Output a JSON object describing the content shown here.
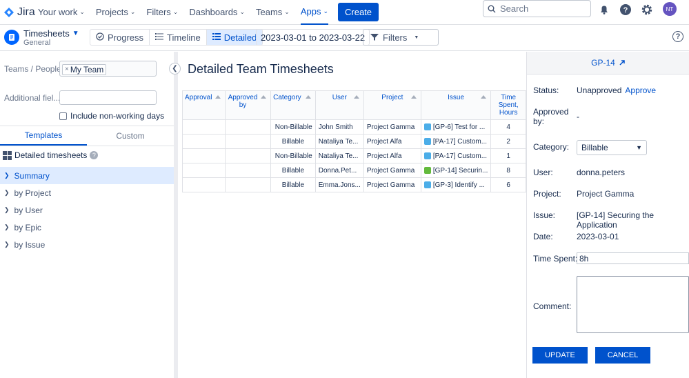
{
  "topnav": {
    "brand": "Jira",
    "items": [
      {
        "label": "Your work",
        "active": false
      },
      {
        "label": "Projects",
        "active": false
      },
      {
        "label": "Filters",
        "active": false
      },
      {
        "label": "Dashboards",
        "active": false
      },
      {
        "label": "Teams",
        "active": false
      },
      {
        "label": "Apps",
        "active": true
      }
    ],
    "create_label": "Create",
    "search_placeholder": "Search",
    "avatar_initials": "NT"
  },
  "subbar": {
    "app_title": "Timesheets",
    "app_subtitle": "General",
    "views": [
      {
        "label": "Progress",
        "icon": "progress-icon",
        "selected": false
      },
      {
        "label": "Timeline",
        "icon": "list-icon",
        "selected": false
      },
      {
        "label": "Detailed",
        "icon": "grid-icon",
        "selected": true
      }
    ],
    "date_range": "2023-03-01 to 2023-03-22",
    "filters_label": "Filters"
  },
  "left": {
    "teams_label": "Teams / People:",
    "team_tag": "My Team",
    "additional_label": "Additional fiel...",
    "nonworking_label": "Include non-working days",
    "tabs": [
      {
        "label": "Templates",
        "selected": true
      },
      {
        "label": "Custom",
        "selected": false
      }
    ],
    "section_title": "Detailed timesheets",
    "tree": [
      {
        "label": "Summary",
        "selected": true
      },
      {
        "label": "by Project",
        "selected": false
      },
      {
        "label": "by User",
        "selected": false
      },
      {
        "label": "by Epic",
        "selected": false
      },
      {
        "label": "by Issue",
        "selected": false
      }
    ]
  },
  "main": {
    "title": "Detailed Team Timesheets",
    "columns": [
      "Approval",
      "Approved by",
      "Category",
      "User",
      "Project",
      "Issue",
      "Time Spent, Hours"
    ],
    "rows": [
      {
        "approval": "",
        "approved_by": "",
        "category": "Non-Billable",
        "user": "John Smith",
        "project": "Project Gamma",
        "issue": "[GP-6] Test for ...",
        "issue_type": "task",
        "hours": "4"
      },
      {
        "approval": "",
        "approved_by": "",
        "category": "Billable",
        "user": "Nataliya Te...",
        "project": "Project Alfa",
        "issue": "[PA-17] Custom...",
        "issue_type": "check",
        "hours": "2"
      },
      {
        "approval": "",
        "approved_by": "",
        "category": "Non-Billable",
        "user": "Nataliya Te...",
        "project": "Project Alfa",
        "issue": "[PA-17] Custom...",
        "issue_type": "check",
        "hours": "1"
      },
      {
        "approval": "",
        "approved_by": "",
        "category": "Billable",
        "user": "Donna.Pet...",
        "project": "Project Gamma",
        "issue": "[GP-14] Securin...",
        "issue_type": "story",
        "hours": "8"
      },
      {
        "approval": "",
        "approved_by": "",
        "category": "Billable",
        "user": "Emma.Jons...",
        "project": "Project Gamma",
        "issue": "[GP-3] Identify ...",
        "issue_type": "task",
        "hours": "6"
      }
    ]
  },
  "right": {
    "header_link": "GP-14",
    "status_label": "Status:",
    "status_value": "Unapproved",
    "approve_link": "Approve",
    "approved_by_label": "Approved by:",
    "approved_by_value": "-",
    "category_label": "Category:",
    "category_value": "Billable",
    "user_label": "User:",
    "user_value": "donna.peters",
    "project_label": "Project:",
    "project_value": "Project Gamma",
    "issue_label": "Issue:",
    "issue_value": "[GP-14] Securing the Application",
    "date_label": "Date:",
    "date_value": "2023-03-01",
    "time_label": "Time Spent:",
    "time_value": "8h",
    "comment_label": "Comment:",
    "update_label": "UPDATE",
    "cancel_label": "CANCEL"
  },
  "colors": {
    "brand": "#0052cc",
    "selected_bg": "#deebff",
    "task": "#4bade8",
    "check": "#4bade8",
    "story": "#63ba3c"
  }
}
